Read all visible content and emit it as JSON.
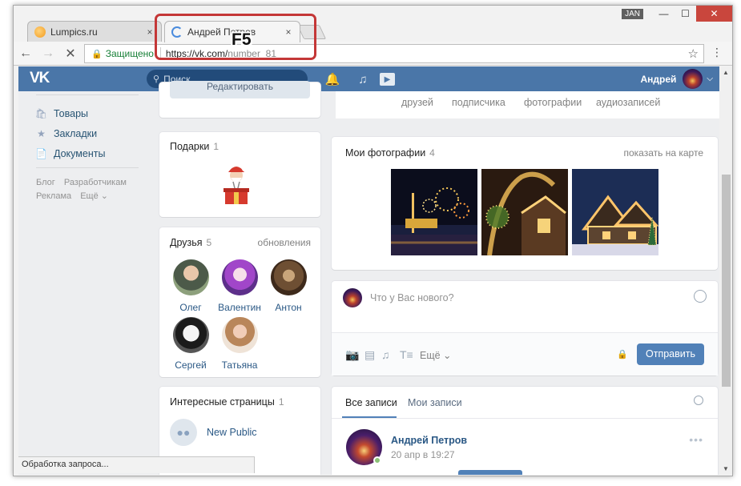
{
  "browser": {
    "tabs": [
      {
        "title": "Lumpics.ru",
        "close": "×"
      },
      {
        "title": "Андрей Петров",
        "close": "×"
      }
    ],
    "window_user": "JAN",
    "window_buttons": {
      "minimize": "—",
      "maximize": "☐",
      "close": "✕"
    },
    "omnibox": {
      "secure_label": "Защищено",
      "url_main": "https://vk.com/",
      "url_path": "number_81"
    },
    "status": "Обработка запроса..."
  },
  "annotation": {
    "key_label": "F5",
    "highlight_color": "#c43737"
  },
  "vk": {
    "header": {
      "logo": "VK",
      "search_placeholder": "Поиск",
      "user_name": "Андрей"
    },
    "left_menu": {
      "items": [
        {
          "label": "Товары",
          "icon": "bag-icon"
        },
        {
          "label": "Закладки",
          "icon": "star-icon"
        },
        {
          "label": "Документы",
          "icon": "document-icon"
        }
      ],
      "footer": [
        "Блог",
        "Разработчикам",
        "Реклама",
        "Ещё ⌄"
      ]
    },
    "profile": {
      "edit_label": "Редактировать"
    },
    "stats": [
      "друзей",
      "подписчика",
      "фотографии",
      "аудиозаписей"
    ],
    "gifts": {
      "title": "Подарки",
      "count": "1"
    },
    "friends": {
      "title": "Друзья",
      "count": "5",
      "updates": "обновления",
      "list": [
        "Олег",
        "Валентин",
        "Антон",
        "Сергей",
        "Татьяна"
      ]
    },
    "pages": {
      "title": "Интересные страницы",
      "count": "1",
      "items": [
        "New Public"
      ]
    },
    "photos": {
      "title": "Мои фотографии",
      "count": "4",
      "map_link": "показать на карте"
    },
    "composer": {
      "placeholder": "Что у Вас нового?",
      "more": "Ещё ⌄",
      "send": "Отправить"
    },
    "wall": {
      "tabs": [
        "Все записи",
        "Мои записи"
      ],
      "post": {
        "author": "Андрей Петров",
        "date": "20 апр в 19:27"
      }
    }
  },
  "colors": {
    "vk_blue": "#4a76a8",
    "vk_button": "#5181b8",
    "link": "#2a5885",
    "page_bg": "#edeef0"
  }
}
